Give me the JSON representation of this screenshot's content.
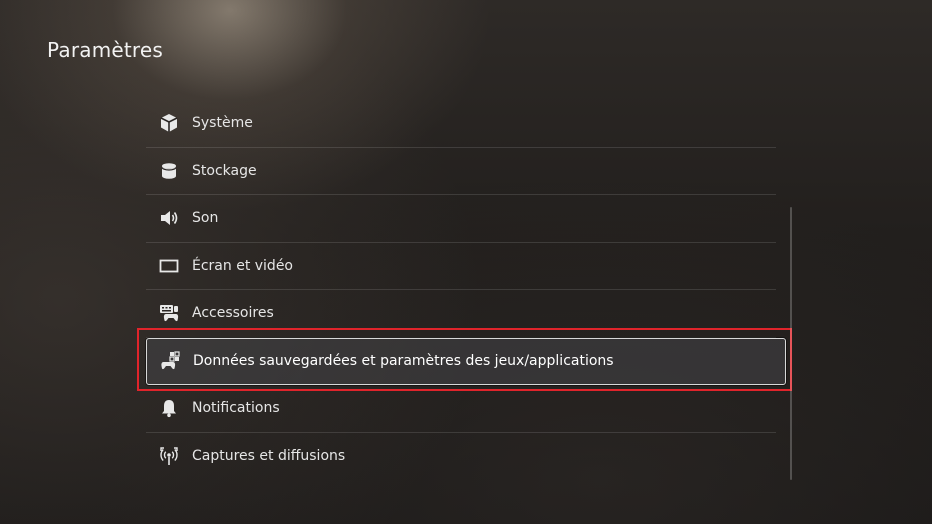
{
  "header": {
    "title": "Paramètres"
  },
  "menu": {
    "items": [
      {
        "label": "Système",
        "icon": "cube-icon"
      },
      {
        "label": "Stockage",
        "icon": "storage-icon"
      },
      {
        "label": "Son",
        "icon": "speaker-icon"
      },
      {
        "label": "Écran et vidéo",
        "icon": "screen-icon"
      },
      {
        "label": "Accessoires",
        "icon": "accessories-icon"
      },
      {
        "label": "Données sauvegardées et paramètres des jeux/applications",
        "icon": "saved-data-icon",
        "focused": true
      },
      {
        "label": "Notifications",
        "icon": "bell-icon"
      },
      {
        "label": "Captures et diffusions",
        "icon": "capture-icon"
      }
    ]
  },
  "colors": {
    "highlight": "#e0242b",
    "focus_border": "#d8d8d8",
    "text": "#e6e6e6"
  }
}
